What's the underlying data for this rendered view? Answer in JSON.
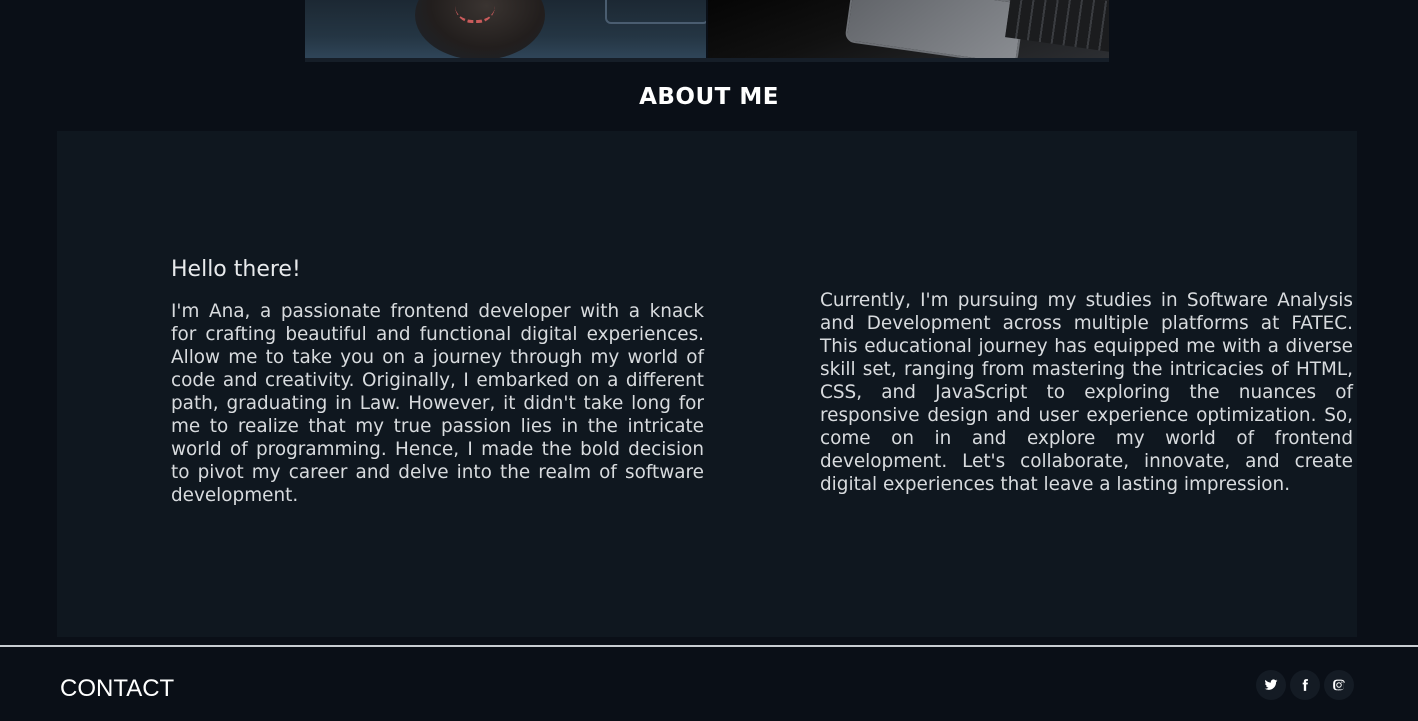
{
  "about": {
    "title": "ABOUT ME",
    "greeting": "Hello there!",
    "paragraph_left": "I'm Ana, a passionate frontend developer with a knack for crafting beautiful and functional digital experiences. Allow me to take you on a journey through my world of code and creativity. Originally, I embarked on a different path, graduating in Law. However, it didn't take long for me to realize that my true passion lies in the intricate world of programming. Hence, I made the bold decision to pivot my career and delve into the realm of software development.",
    "paragraph_right": "Currently, I'm pursuing my studies in Software Analysis and Development across multiple platforms at FATEC. This educational journey has equipped me with a diverse skill set, ranging from mastering the intricacies of HTML, CSS, and JavaScript to exploring the nuances of responsive design and user experience optimization. So, come on in and explore my world of frontend development. Let's collaborate, innovate, and create digital experiences that leave a lasting impression."
  },
  "footer": {
    "contact_title": "CONTACT",
    "social_icons": [
      "twitter-icon",
      "facebook-icon",
      "instagram-icon"
    ]
  },
  "colors": {
    "background": "#0a0f17",
    "panel": "#0f171f",
    "text": "#d8dbde",
    "divider": "#c8cdd2"
  }
}
